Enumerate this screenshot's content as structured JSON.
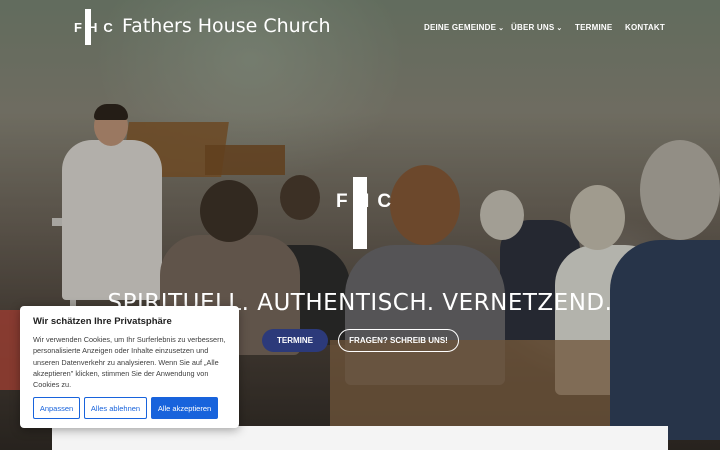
{
  "header": {
    "logo_text": "FHC",
    "brand": "Fathers House Church",
    "nav": [
      {
        "label": "DEINE GEMEINDE",
        "has_dropdown": true
      },
      {
        "label": "ÜBER UNS",
        "has_dropdown": true
      },
      {
        "label": "TERMINE",
        "has_dropdown": false
      },
      {
        "label": "KONTAKT",
        "has_dropdown": false
      }
    ],
    "dropdown_glyph": "⌄"
  },
  "hero": {
    "logo_text": "FHC",
    "tagline": "SPIRITUELL. AUTHENTISCH. VERNETZEND.",
    "primary_button": "TERMINE",
    "secondary_button": "FRAGEN? SCHREIB UNS!",
    "primary_color": "#2c3a7a"
  },
  "cookie_banner": {
    "title": "Wir schätzen Ihre Privatsphäre",
    "text": "Wir verwenden Cookies, um Ihr Surferlebnis zu verbessern, personalisierte Anzeigen oder Inhalte einzusetzen und unseren Datenverkehr zu analysieren. Wenn Sie auf „Alle akzeptieren\" klicken, stimmen Sie der Anwendung von Cookies zu.",
    "buttons": {
      "customize": "Anpassen",
      "reject": "Alles ablehnen",
      "accept": "Alle akzeptieren"
    },
    "accent_color": "#1863dc"
  }
}
